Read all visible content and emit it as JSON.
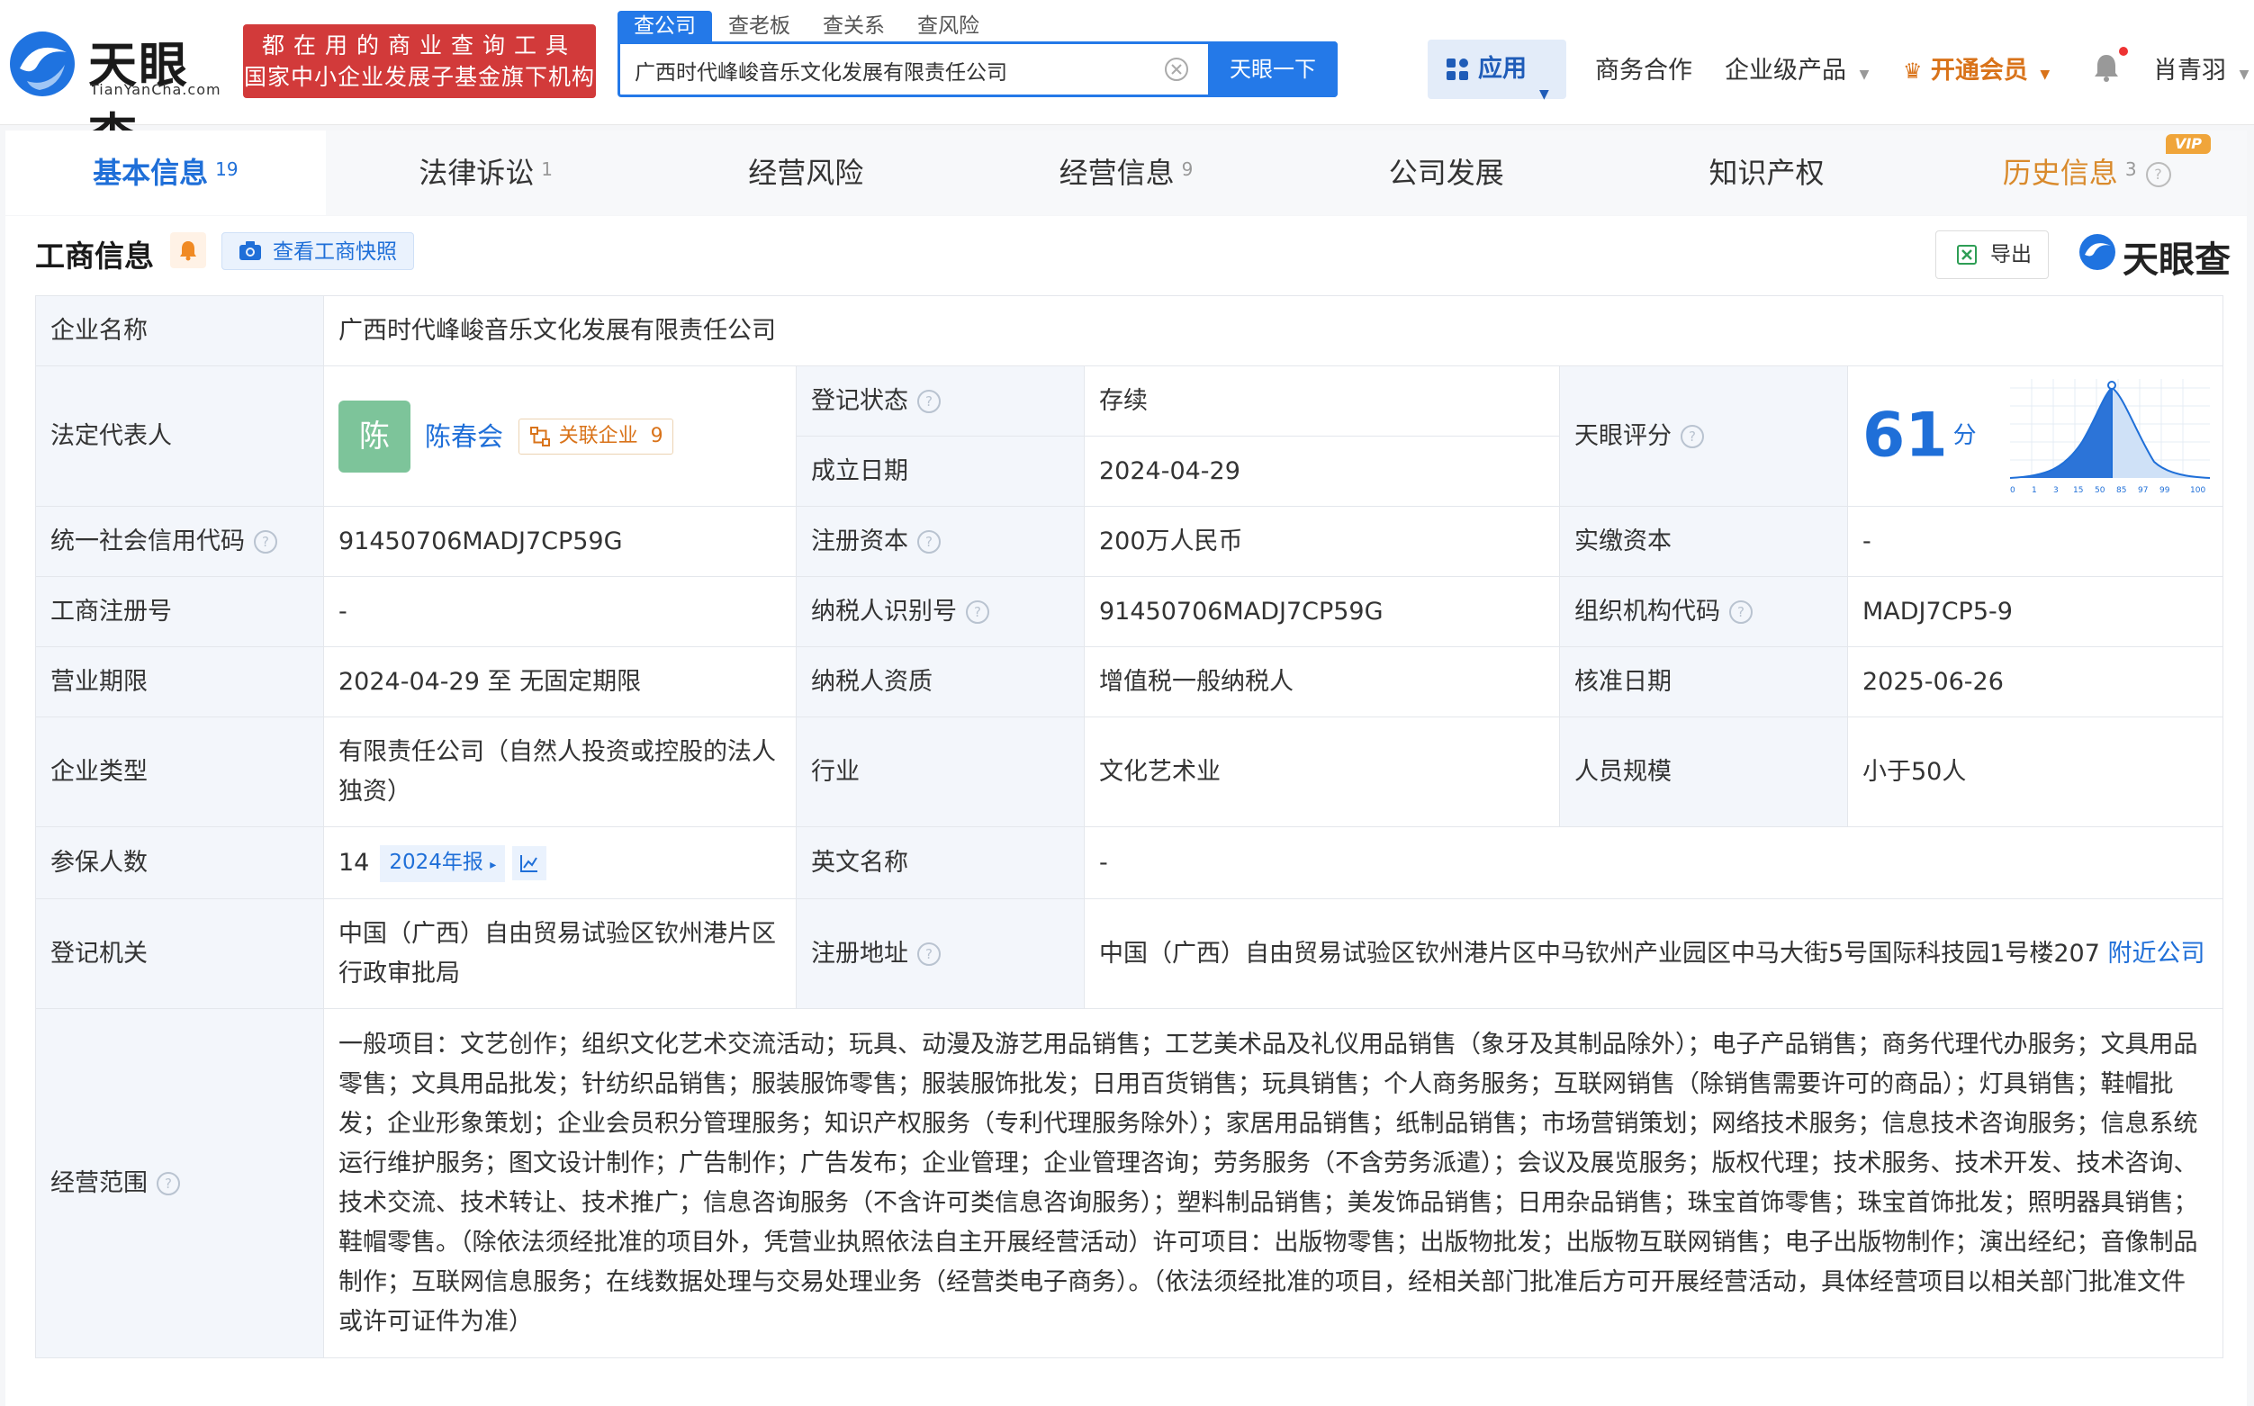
{
  "header": {
    "logo_text": "天眼查",
    "logo_sub": "TianYanCha.com",
    "promo_line1": "都在用的商业查询工具",
    "promo_line2": "国家中小企业发展子基金旗下机构",
    "search_tabs": [
      "查公司",
      "查老板",
      "查关系",
      "查风险"
    ],
    "search_value": "广西时代峰峻音乐文化发展有限责任公司",
    "search_button": "天眼一下",
    "app_label": "应用",
    "nav": [
      "商务合作",
      "企业级产品",
      "开通会员"
    ],
    "user": "肖青羽"
  },
  "tabs": [
    {
      "label": "基本信息",
      "count": "19"
    },
    {
      "label": "法律诉讼",
      "count": "1"
    },
    {
      "label": "经营风险",
      "count": ""
    },
    {
      "label": "经营信息",
      "count": "9"
    },
    {
      "label": "公司发展",
      "count": ""
    },
    {
      "label": "知识产权",
      "count": ""
    },
    {
      "label": "历史信息",
      "count": "3",
      "badge": "VIP"
    }
  ],
  "section": {
    "title": "工商信息",
    "snapshot_button": "查看工商快照",
    "export_button": "导出",
    "brand": "天眼查"
  },
  "info": {
    "company_name_label": "企业名称",
    "company_name": "广西时代峰峻音乐文化发展有限责任公司",
    "legal_rep_label": "法定代表人",
    "legal_rep_avatar": "陈",
    "legal_rep_name": "陈春会",
    "assoc_label": "关联企业",
    "assoc_count": "9",
    "reg_status_label": "登记状态",
    "reg_status": "存续",
    "found_date_label": "成立日期",
    "found_date": "2024-04-29",
    "score_label": "天眼评分",
    "score": "61",
    "score_unit": "分",
    "score_axis": [
      "0",
      "1",
      "3",
      "15",
      "50",
      "85",
      "97",
      "99",
      "100"
    ],
    "credit_code_label": "统一社会信用代码",
    "credit_code": "91450706MADJ7CP59G",
    "reg_capital_label": "注册资本",
    "reg_capital": "200万人民币",
    "paid_capital_label": "实缴资本",
    "paid_capital": "-",
    "reg_no_label": "工商注册号",
    "reg_no": "-",
    "taxpayer_id_label": "纳税人识别号",
    "taxpayer_id": "91450706MADJ7CP59G",
    "org_code_label": "组织机构代码",
    "org_code": "MADJ7CP5-9",
    "term_label": "营业期限",
    "term": "2024-04-29 至 无固定期限",
    "taxpayer_qual_label": "纳税人资质",
    "taxpayer_qual": "增值税一般纳税人",
    "approve_date_label": "核准日期",
    "approve_date": "2025-06-26",
    "type_label": "企业类型",
    "type": "有限责任公司（自然人投资或控股的法人独资）",
    "industry_label": "行业",
    "industry": "文化艺术业",
    "staff_label": "人员规模",
    "staff": "小于50人",
    "insured_label": "参保人数",
    "insured": "14",
    "insured_year": "2024年报",
    "en_name_label": "英文名称",
    "en_name": "-",
    "authority_label": "登记机关",
    "authority": "中国（广西）自由贸易试验区钦州港片区行政审批局",
    "address_label": "注册地址",
    "address": "中国（广西）自由贸易试验区钦州港片区中马钦州产业园区中马大街5号国际科技园1号楼207",
    "nearby": "附近公司",
    "scope_label": "经营范围",
    "scope": "一般项目：文艺创作；组织文化艺术交流活动；玩具、动漫及游艺用品销售；工艺美术品及礼仪用品销售（象牙及其制品除外）；电子产品销售；商务代理代办服务；文具用品零售；文具用品批发；针纺织品销售；服装服饰零售；服装服饰批发；日用百货销售；玩具销售；个人商务服务；互联网销售（除销售需要许可的商品）；灯具销售；鞋帽批发；企业形象策划；企业会员积分管理服务；知识产权服务（专利代理服务除外）；家居用品销售；纸制品销售；市场营销策划；网络技术服务；信息技术咨询服务；信息系统运行维护服务；图文设计制作；广告制作；广告发布；企业管理；企业管理咨询；劳务服务（不含劳务派遣）；会议及展览服务；版权代理；技术服务、技术开发、技术咨询、技术交流、技术转让、技术推广；信息咨询服务（不含许可类信息咨询服务）；塑料制品销售；美发饰品销售；日用杂品销售；珠宝首饰零售；珠宝首饰批发；照明器具销售；鞋帽零售。（除依法须经批准的项目外，凭营业执照依法自主开展经营活动）许可项目：出版物零售；出版物批发；出版物互联网销售；电子出版物制作；演出经纪；音像制品制作；互联网信息服务；在线数据处理与交易处理业务（经营类电子商务）。（依法须经批准的项目，经相关部门批准后方可开展经营活动，具体经营项目以相关部门批准文件或许可证件为准）"
  },
  "colors": {
    "primary": "#2479e8",
    "promo": "#d23a3a",
    "status_green": "#28a745",
    "vip_orange": "#d9731a"
  }
}
